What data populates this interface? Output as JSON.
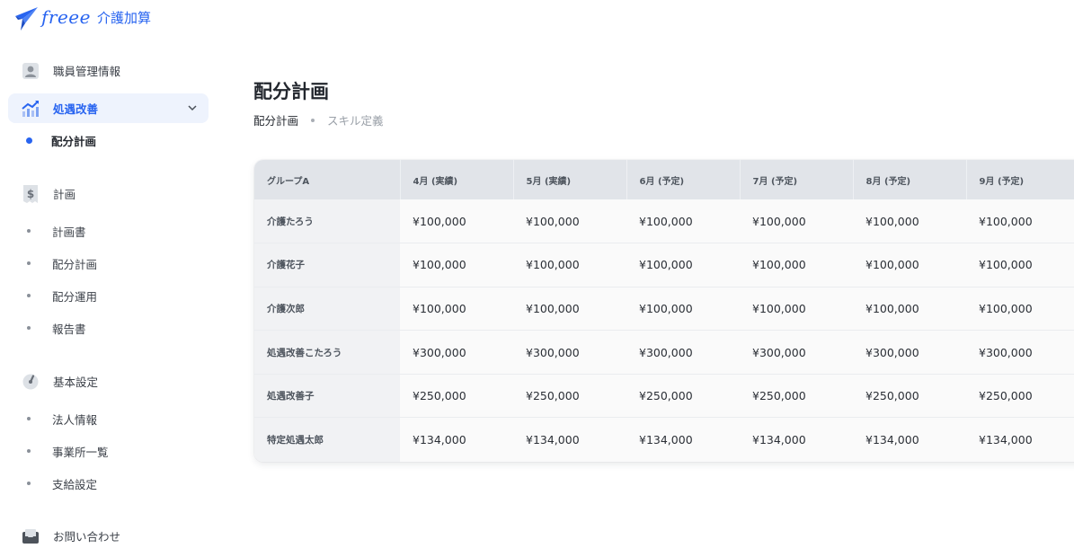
{
  "brand": {
    "product": "介護加算"
  },
  "sidebar": {
    "staff": {
      "label": "職員管理情報",
      "icon": "person-icon"
    },
    "treatment": {
      "label": "処遇改善",
      "icon": "chart-up-icon",
      "items": [
        {
          "label": "配分計画",
          "current": true
        }
      ]
    },
    "plan": {
      "label": "計画",
      "icon": "receipt-dollar-icon",
      "items": [
        {
          "label": "計画書"
        },
        {
          "label": "配分計画"
        },
        {
          "label": "配分運用"
        },
        {
          "label": "報告書"
        }
      ]
    },
    "settings": {
      "label": "基本設定",
      "icon": "gauge-icon",
      "items": [
        {
          "label": "法人情報"
        },
        {
          "label": "事業所一覧"
        },
        {
          "label": "支給設定"
        }
      ]
    },
    "contact": {
      "label": "お問い合わせ",
      "icon": "mail-inbox-icon"
    }
  },
  "main": {
    "title": "配分計画",
    "tabs": [
      {
        "label": "配分計画",
        "active": true
      },
      {
        "label": "スキル定義",
        "active": false
      }
    ],
    "table": {
      "group_header": "グループA",
      "columns": [
        "4月 (実績)",
        "5月 (実績)",
        "6月 (予定)",
        "7月 (予定)",
        "8月 (予定)",
        "9月 (予定)"
      ],
      "rows": [
        {
          "name": "介護たろう",
          "values": [
            "¥100,000",
            "¥100,000",
            "¥100,000",
            "¥100,000",
            "¥100,000",
            "¥100,000"
          ]
        },
        {
          "name": "介護花子",
          "values": [
            "¥100,000",
            "¥100,000",
            "¥100,000",
            "¥100,000",
            "¥100,000",
            "¥100,000"
          ]
        },
        {
          "name": "介護次郎",
          "values": [
            "¥100,000",
            "¥100,000",
            "¥100,000",
            "¥100,000",
            "¥100,000",
            "¥100,000"
          ]
        },
        {
          "name": "処遇改善こたろう",
          "values": [
            "¥300,000",
            "¥300,000",
            "¥300,000",
            "¥300,000",
            "¥300,000",
            "¥300,000"
          ]
        },
        {
          "name": "処遇改善子",
          "values": [
            "¥250,000",
            "¥250,000",
            "¥250,000",
            "¥250,000",
            "¥250,000",
            "¥250,000"
          ]
        },
        {
          "name": "特定処遇太郎",
          "values": [
            "¥134,000",
            "¥134,000",
            "¥134,000",
            "¥134,000",
            "¥134,000",
            "¥134,000"
          ]
        }
      ]
    }
  },
  "colors": {
    "accent": "#2864f0",
    "active_bg": "#eef3fd",
    "header_bg": "#e1e4e9"
  }
}
